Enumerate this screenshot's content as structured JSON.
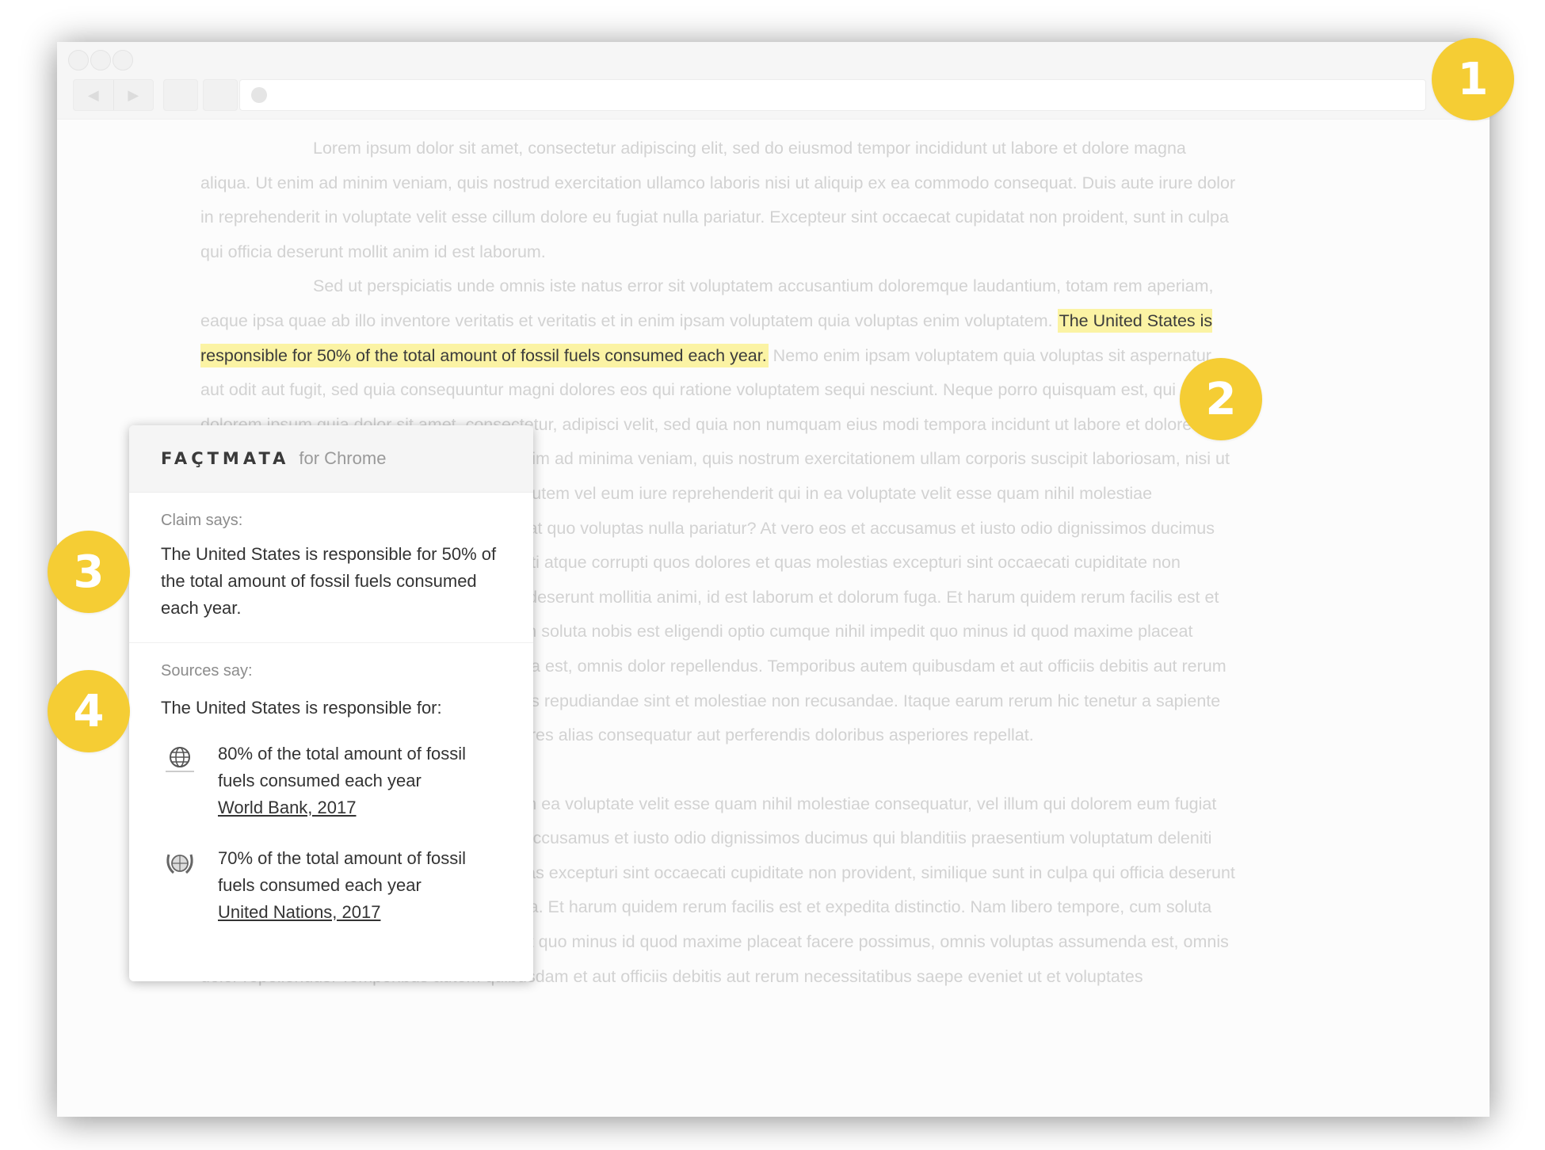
{
  "paragraphs": {
    "p1": "Lorem ipsum dolor sit amet, consectetur adipiscing elit, sed do eiusmod tempor incididunt ut labore et dolore magna aliqua. Ut enim ad minim veniam, quis nostrud exercitation ullamco laboris nisi ut aliquip ex ea commodo consequat. Duis aute irure dolor in reprehenderit in voluptate velit esse cillum dolore eu fugiat nulla pariatur. Excepteur sint occaecat cupidatat non proident, sunt in culpa qui officia deserunt mollit anim id est laborum.",
    "p2_before": "Sed ut perspiciatis unde omnis iste natus error sit voluptatem accusantium doloremque laudantium, totam rem aperiam, eaque ipsa quae ab illo inventore veritatis et veritatis et in enim ipsam voluptatem quia voluptas enim voluptatem.",
    "p2_highlight": "The United States is responsible for 50% of the total amount of fossil fuels consumed each year.",
    "p2_after": "Nemo enim ipsam voluptatem quia voluptas sit aspernatur aut odit aut fugit, sed quia consequuntur magni dolores eos qui ratione voluptatem sequi nesciunt. Neque porro quisquam est, qui dolorem ipsum quia dolor sit amet, consectetur, adipisci velit, sed quia non numquam eius modi tempora incidunt ut labore et dolore magnam aliquam quaerat voluptatem. Ut enim ad minima veniam, quis nostrum exercitationem ullam corporis suscipit laboriosam, nisi ut aliquid ex ea commodi consequatur? Quis autem vel eum iure reprehenderit qui in ea voluptate velit esse quam nihil molestiae consequatur, vel illum qui dolorem eum fugiat quo voluptas nulla pariatur? At vero eos et accusamus et iusto odio dignissimos ducimus qui blanditiis praesentium voluptatum deleniti atque corrupti quos dolores et quas molestias excepturi sint occaecati cupiditate non provident, similique sunt in culpa qui officia deserunt mollitia animi, id est laborum et dolorum fuga. Et harum quidem rerum facilis est et expedita distinctio. Nam libero tempore, cum soluta nobis est eligendi optio cumque nihil impedit quo minus id quod maxime placeat facere possimus, omnis voluptas assumenda est, omnis dolor repellendus. Temporibus autem quibusdam et aut officiis debitis aut rerum necessitatibus saepe eveniet ut et voluptates repudiandae sint et molestiae non recusandae. Itaque earum rerum hic tenetur a sapiente delectus, ut aut reiciendis voluptatibus maiores alias consequatur aut perferendis doloribus asperiores repellat.",
    "p3": "Quis autem vel eum iure reprehenderit qui in ea voluptate velit esse quam nihil molestiae consequatur, vel illum qui dolorem eum fugiat quo voluptas nulla pariatur? At vero eos et accusamus et iusto odio dignissimos ducimus qui blanditiis praesentium voluptatum deleniti atque corrupti quos dolores et quas molestias excepturi sint occaecati cupiditate non provident, similique sunt in culpa qui officia deserunt mollitia animi, id est laborum et dolorum fuga. Et harum quidem rerum facilis est et expedita distinctio. Nam libero tempore, cum soluta nobis est eligendi optio cumque nihil impedit quo minus id quod maxime placeat facere possimus, omnis voluptas assumenda est, omnis dolor repellendus. Temporibus autem quibusdam et aut officiis debitis aut rerum necessitatibus saepe eveniet ut et voluptates"
  },
  "popup": {
    "brand": "FAÇTMATA",
    "brand_suffix": "for Chrome",
    "claim_label": "Claim says:",
    "claim_text": "The United States is responsible for 50% of the total amount of fossil fuels consumed each year.",
    "sources_label": "Sources say:",
    "sources_intro": "The United States is responsible for:",
    "sources": [
      {
        "icon": "globe-icon",
        "text": "80% of the total amount of fossil fuels consumed each year",
        "link": "World Bank, 2017"
      },
      {
        "icon": "un-emblem-icon",
        "text": "70% of the total amount of fossil fuels consumed each year",
        "link": "United Nations, 2017"
      }
    ]
  },
  "badges": [
    "1",
    "2",
    "3",
    "4"
  ],
  "colors": {
    "badge": "#f5cd34",
    "highlight": "#fbf3a4"
  }
}
